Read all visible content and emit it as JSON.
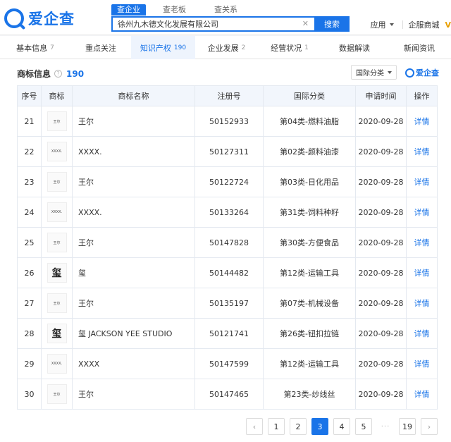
{
  "brand": {
    "name": "爱企查"
  },
  "search": {
    "tabs": [
      "查企业",
      "查老板",
      "查关系"
    ],
    "query": "徐州九木德文化发展有限公司",
    "button": "搜索"
  },
  "header": {
    "app_menu": "应用",
    "enterprise_mall": "企服商城"
  },
  "nav": [
    {
      "label": "基本信息",
      "count": "7"
    },
    {
      "label": "重点关注",
      "count": ""
    },
    {
      "label": "知识产权",
      "count": "190"
    },
    {
      "label": "企业发展",
      "count": "2"
    },
    {
      "label": "经营状况",
      "count": "1"
    },
    {
      "label": "数据解读",
      "count": ""
    },
    {
      "label": "新闻资讯",
      "count": ""
    }
  ],
  "section": {
    "title": "商标信息",
    "count": "190",
    "filter": "国际分类",
    "watermark": "爱企查"
  },
  "table": {
    "headers": [
      "序号",
      "商标",
      "商标名称",
      "注册号",
      "国际分类",
      "申请时间",
      "操作"
    ],
    "rows": [
      {
        "no": "21",
        "thumb": "王尔",
        "name": "王尔",
        "reg": "50152933",
        "cls": "第04类-燃料油脂",
        "date": "2020-09-28",
        "action": "详情"
      },
      {
        "no": "22",
        "thumb": "XXXX.",
        "name": "XXXX.",
        "reg": "50127311",
        "cls": "第02类-颜料油漆",
        "date": "2020-09-28",
        "action": "详情"
      },
      {
        "no": "23",
        "thumb": "王尔",
        "name": "王尔",
        "reg": "50122724",
        "cls": "第03类-日化用品",
        "date": "2020-09-28",
        "action": "详情"
      },
      {
        "no": "24",
        "thumb": "XXXX.",
        "name": "XXXX.",
        "reg": "50133264",
        "cls": "第31类-饲料种籽",
        "date": "2020-09-28",
        "action": "详情"
      },
      {
        "no": "25",
        "thumb": "王尔",
        "name": "王尔",
        "reg": "50147828",
        "cls": "第30类-方便食品",
        "date": "2020-09-28",
        "action": "详情"
      },
      {
        "no": "26",
        "thumb": "玺",
        "name": "玺",
        "reg": "50144482",
        "cls": "第12类-运输工具",
        "date": "2020-09-28",
        "action": "详情"
      },
      {
        "no": "27",
        "thumb": "王尔",
        "name": "王尔",
        "reg": "50135197",
        "cls": "第07类-机械设备",
        "date": "2020-09-28",
        "action": "详情"
      },
      {
        "no": "28",
        "thumb": "玺",
        "name": "玺 JACKSON YEE STUDIO",
        "reg": "50121741",
        "cls": "第26类-钮扣拉链",
        "date": "2020-09-28",
        "action": "详情"
      },
      {
        "no": "29",
        "thumb": "XXXX.",
        "name": "XXXX",
        "reg": "50147599",
        "cls": "第12类-运输工具",
        "date": "2020-09-28",
        "action": "详情"
      },
      {
        "no": "30",
        "thumb": "王尔",
        "name": "王尔",
        "reg": "50147465",
        "cls": "第23类-纱线丝",
        "date": "2020-09-28",
        "action": "详情"
      }
    ]
  },
  "pagination": {
    "pages": [
      "1",
      "2",
      "3",
      "4",
      "5"
    ],
    "current": "3",
    "ellipsis": "···",
    "last": "19",
    "prev": "‹",
    "next": "›"
  },
  "colors": {
    "accent": "#1a74e8",
    "header_bg": "#f2f6fc"
  }
}
